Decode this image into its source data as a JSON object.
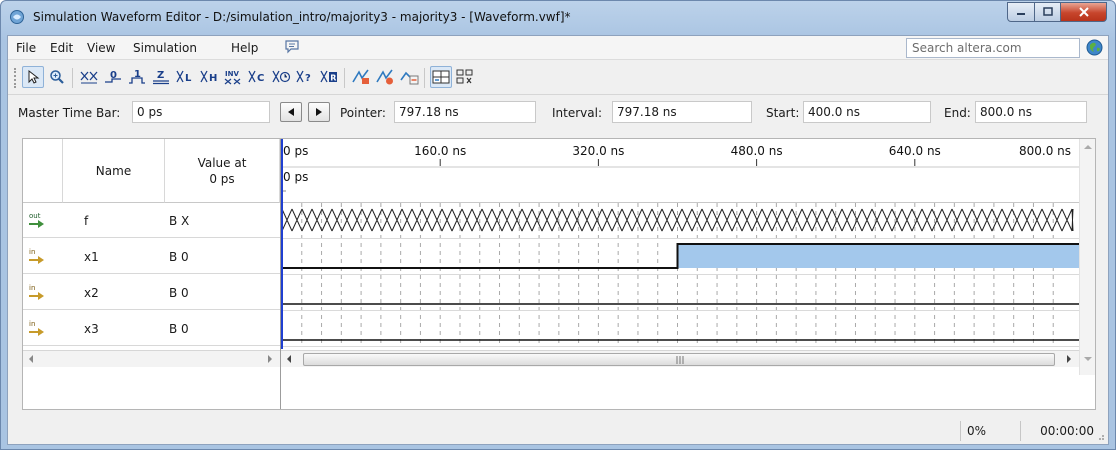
{
  "window": {
    "title": "Simulation Waveform Editor - D:/simulation_intro/majority3 - majority3 - [Waveform.vwf]*"
  },
  "menu": {
    "items": [
      "File",
      "Edit",
      "View",
      "Simulation",
      "Help"
    ],
    "search_placeholder": "Search altera.com"
  },
  "toolbar": {
    "buttons": [
      {
        "icon": "select-pointer-icon",
        "active": true
      },
      {
        "icon": "zoom-icon"
      },
      {
        "icon": "force-unknown-icon",
        "glyph": "X"
      },
      {
        "icon": "force-low-icon",
        "glyph": "0"
      },
      {
        "icon": "force-high-icon",
        "glyph": "1"
      },
      {
        "icon": "force-high-impedance-icon",
        "glyph": "Z"
      },
      {
        "icon": "weak-low-icon",
        "glyph": "L"
      },
      {
        "icon": "weak-high-icon",
        "glyph": "H"
      },
      {
        "icon": "invert-icon",
        "glyph": "INV"
      },
      {
        "icon": "count-value-icon",
        "glyph": "C"
      },
      {
        "icon": "clock-icon",
        "glyph": "C"
      },
      {
        "icon": "arbitrary-value-icon",
        "glyph": "?"
      },
      {
        "icon": "random-value-icon",
        "glyph": "R"
      },
      {
        "icon": "run-functional-simulation-icon"
      },
      {
        "icon": "run-timing-simulation-icon"
      },
      {
        "icon": "generate-netlist-icon"
      },
      {
        "icon": "snap-to-grid-icon",
        "active": true
      },
      {
        "icon": "sort-icon"
      }
    ]
  },
  "timebar": {
    "master_label": "Master Time Bar:",
    "master_value": "0 ps",
    "pointer_label": "Pointer:",
    "pointer_value": "797.18 ns",
    "interval_label": "Interval:",
    "interval_value": "797.18 ns",
    "start_label": "Start:",
    "start_value": "400.0 ns",
    "end_label": "End:",
    "end_value": "800.0 ns"
  },
  "signals": {
    "header_name": "Name",
    "header_value": "Value at\n0 ps",
    "rows": [
      {
        "dir": "out",
        "name": "f",
        "value": "B X"
      },
      {
        "dir": "in",
        "name": "x1",
        "value": "B 0"
      },
      {
        "dir": "in",
        "name": "x2",
        "value": "B 0"
      },
      {
        "dir": "in",
        "name": "x3",
        "value": "B 0"
      }
    ]
  },
  "waveform": {
    "time_range_ns": [
      0,
      800
    ],
    "ticks": [
      "0 ps",
      "160.0 ns",
      "320.0 ns",
      "480.0 ns",
      "640.0 ns",
      "800.0 ns"
    ],
    "cursor_label": "0 ps",
    "x1_rise_ns": 400,
    "highlight_color": "#a3c8ec",
    "grid_color": "#a9a9a9"
  },
  "status": {
    "progress": "0%",
    "elapsed": "00:00:00"
  }
}
